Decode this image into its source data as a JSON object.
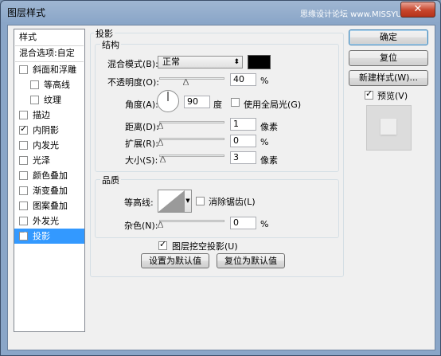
{
  "window": {
    "title": "图层样式",
    "watermark": "思缘设计论坛 www.MISSYUAN.COM",
    "close_glyph": "✕"
  },
  "sidebar": {
    "header": "样式",
    "blend_options": "混合选项:自定",
    "items": [
      {
        "label": "斜面和浮雕",
        "checked": false
      },
      {
        "label": "等高线",
        "checked": false
      },
      {
        "label": "纹理",
        "checked": false
      },
      {
        "label": "描边",
        "checked": false
      },
      {
        "label": "内阴影",
        "checked": true
      },
      {
        "label": "内发光",
        "checked": false
      },
      {
        "label": "光泽",
        "checked": false
      },
      {
        "label": "颜色叠加",
        "checked": false
      },
      {
        "label": "渐变叠加",
        "checked": false
      },
      {
        "label": "图案叠加",
        "checked": false
      },
      {
        "label": "外发光",
        "checked": false
      },
      {
        "label": "投影",
        "checked": true,
        "selected": true
      }
    ],
    "check_glyph": "✓"
  },
  "drop_shadow": {
    "section_title": "投影",
    "structure": {
      "title": "结构",
      "blend_mode_label": "混合模式(B):",
      "blend_mode_value": "正常",
      "color": "#000000",
      "opacity_label": "不透明度(O):",
      "opacity_value": "40",
      "opacity_unit": "%",
      "angle_label": "角度(A):",
      "angle_value": "90",
      "angle_unit": "度",
      "global_light_label": "使用全局光(G)",
      "global_light_checked": false,
      "distance_label": "距离(D):",
      "distance_value": "1",
      "distance_unit": "像素",
      "spread_label": "扩展(R):",
      "spread_value": "0",
      "spread_unit": "%",
      "size_label": "大小(S):",
      "size_value": "3",
      "size_unit": "像素"
    },
    "quality": {
      "title": "品质",
      "contour_label": "等高线:",
      "anti_alias_label": "消除锯齿(L)",
      "anti_alias_checked": false,
      "noise_label": "杂色(N):",
      "noise_value": "0",
      "noise_unit": "%"
    },
    "knockout_label": "图层挖空投影(U)",
    "knockout_checked": true,
    "make_default_label": "设置为默认值",
    "reset_default_label": "复位为默认值"
  },
  "buttons": {
    "ok": "确定",
    "reset": "复位",
    "new_style": "新建样式(W)...",
    "preview_label": "预览(V)",
    "preview_checked": true
  }
}
